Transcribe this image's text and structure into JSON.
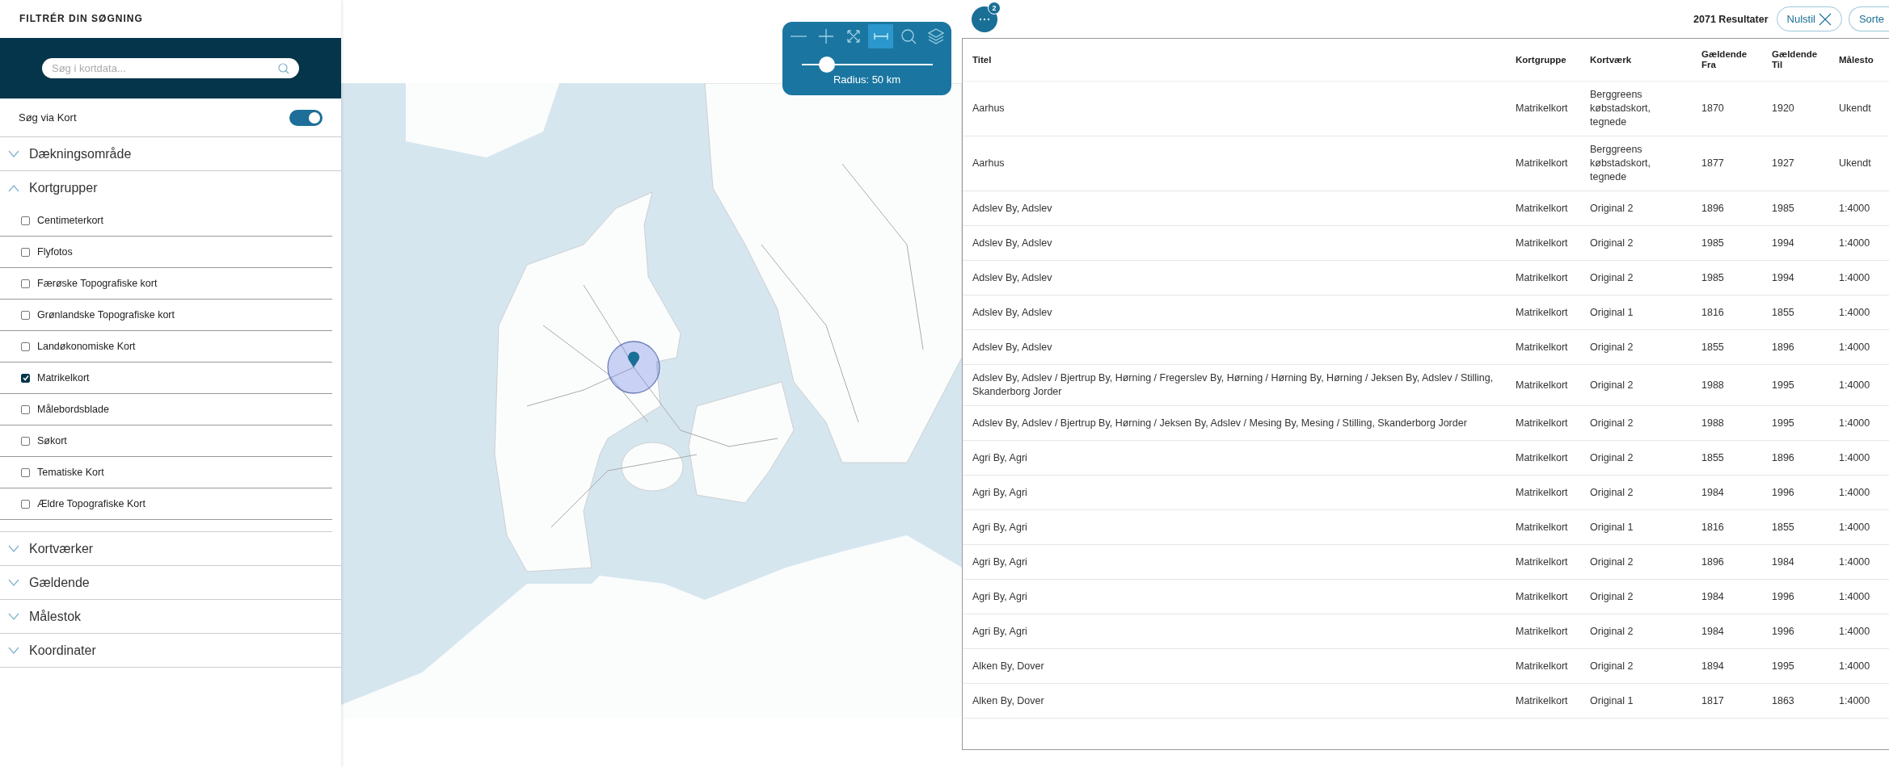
{
  "sidebar": {
    "title": "FILTRÉR DIN SØGNING",
    "search": {
      "placeholder": "Søg i kortdata..."
    },
    "map_toggle": {
      "label": "Søg via Kort",
      "on": true
    },
    "sections": [
      {
        "label": "Dækningsområde",
        "expanded": false
      },
      {
        "label": "Kortgrupper",
        "expanded": true,
        "options": [
          {
            "label": "Centimeterkort",
            "checked": false
          },
          {
            "label": "Flyfotos",
            "checked": false
          },
          {
            "label": "Færøske Topografiske kort",
            "checked": false
          },
          {
            "label": "Grønlandske Topografiske kort",
            "checked": false
          },
          {
            "label": "Landøkonomiske Kort",
            "checked": false
          },
          {
            "label": "Matrikelkort",
            "checked": true
          },
          {
            "label": "Målebordsblade",
            "checked": false
          },
          {
            "label": "Søkort",
            "checked": false
          },
          {
            "label": "Tematiske Kort",
            "checked": false
          },
          {
            "label": "Ældre Topografiske Kort",
            "checked": false
          }
        ]
      },
      {
        "label": "Kortværker",
        "expanded": false
      },
      {
        "label": "Gældende",
        "expanded": false
      },
      {
        "label": "Målestok",
        "expanded": false
      },
      {
        "label": "Koordinater",
        "expanded": false
      }
    ]
  },
  "map": {
    "tools": [
      {
        "kind": "zoom-out",
        "selected": false
      },
      {
        "kind": "zoom-in",
        "selected": false
      },
      {
        "kind": "extent",
        "selected": false
      },
      {
        "kind": "radius",
        "selected": true
      },
      {
        "kind": "search",
        "selected": false
      },
      {
        "kind": "layers",
        "selected": false
      }
    ],
    "radius": {
      "level": 0.15,
      "label": "Radius: 50 km"
    }
  },
  "results": {
    "filter_badge": "2",
    "count": "2071 Resultater",
    "buttons": [
      {
        "kind": "reset",
        "label": "Nulstil"
      },
      {
        "kind": "sort",
        "label": "Sorte"
      }
    ],
    "table": {
      "columns": [
        "Titel",
        "Kortgruppe",
        "Kortværk",
        "Gældende Fra",
        "Gældende Til",
        "Målesto"
      ],
      "rows": [
        [
          "Aarhus",
          "Matrikelkort",
          "Berggreens købstadskort, tegnede",
          "1870",
          "1920",
          "Ukendt"
        ],
        [
          "Aarhus",
          "Matrikelkort",
          "Berggreens købstadskort, tegnede",
          "1877",
          "1927",
          "Ukendt"
        ],
        [
          "Adslev By, Adslev",
          "Matrikelkort",
          "Original 2",
          "1896",
          "1985",
          "1:4000"
        ],
        [
          "Adslev By, Adslev",
          "Matrikelkort",
          "Original 2",
          "1985",
          "1994",
          "1:4000"
        ],
        [
          "Adslev By, Adslev",
          "Matrikelkort",
          "Original 2",
          "1985",
          "1994",
          "1:4000"
        ],
        [
          "Adslev By, Adslev",
          "Matrikelkort",
          "Original 1",
          "1816",
          "1855",
          "1:4000"
        ],
        [
          "Adslev By, Adslev",
          "Matrikelkort",
          "Original 2",
          "1855",
          "1896",
          "1:4000"
        ],
        [
          "Adslev By, Adslev / Bjertrup By, Hørning / Fregerslev By, Hørning / Hørning By, Hørning / Jeksen By, Adslev / Stilling, Skanderborg Jorder",
          "Matrikelkort",
          "Original 2",
          "1988",
          "1995",
          "1:4000"
        ],
        [
          "Adslev By, Adslev / Bjertrup By, Hørning / Jeksen By, Adslev / Mesing By, Mesing / Stilling, Skanderborg Jorder",
          "Matrikelkort",
          "Original 2",
          "1988",
          "1995",
          "1:4000"
        ],
        [
          "Agri By, Agri",
          "Matrikelkort",
          "Original 2",
          "1855",
          "1896",
          "1:4000"
        ],
        [
          "Agri By, Agri",
          "Matrikelkort",
          "Original 2",
          "1984",
          "1996",
          "1:4000"
        ],
        [
          "Agri By, Agri",
          "Matrikelkort",
          "Original 1",
          "1816",
          "1855",
          "1:4000"
        ],
        [
          "Agri By, Agri",
          "Matrikelkort",
          "Original 2",
          "1896",
          "1984",
          "1:4000"
        ],
        [
          "Agri By, Agri",
          "Matrikelkort",
          "Original 2",
          "1984",
          "1996",
          "1:4000"
        ],
        [
          "Agri By, Agri",
          "Matrikelkort",
          "Original 2",
          "1984",
          "1996",
          "1:4000"
        ],
        [
          "Alken By, Dover",
          "Matrikelkort",
          "Original 2",
          "1894",
          "1995",
          "1:4000"
        ],
        [
          "Alken By, Dover",
          "Matrikelkort",
          "Original 1",
          "1817",
          "1863",
          "1:4000"
        ]
      ]
    }
  }
}
